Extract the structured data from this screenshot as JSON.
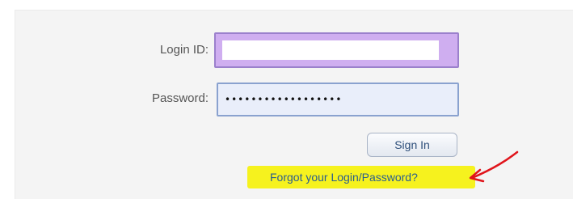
{
  "form": {
    "login_label": "Login ID:",
    "login_value": "",
    "password_label": "Password:",
    "password_value": "••••••••••••••••••",
    "signin_label": "Sign In",
    "forgot_label": "Forgot your Login/Password?"
  },
  "annotation": {
    "highlight_color": "#f6f21e",
    "arrow_color": "#e0141b",
    "arrow_icon": "hand-drawn-arrow-icon"
  },
  "colors": {
    "login_field_focus": "#cfaef0",
    "password_field_bg": "#e9eefa",
    "link_color": "#2a5d8f"
  }
}
